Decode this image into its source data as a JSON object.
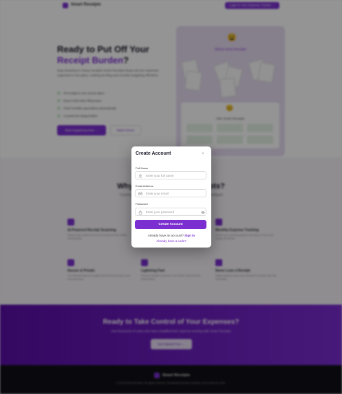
{
  "nav": {
    "brand": "Smart Receipts",
    "cta_label": "Login to Your Expense Tracker →"
  },
  "hero": {
    "title_line1": "Ready to Put Off Your",
    "title_accent": "Receipt Burden",
    "title_end": "?",
    "description": "Stop drowning in messy receipts! Smart Receipts keeps all your expenses organized in one place, making tax filing and monthly budgeting effortless.",
    "checklist": [
      "All receipts in one secure place",
      "Easy to find when filing taxes",
      "Track monthly expenditure automatically",
      "AI-powered categorization"
    ],
    "primary_button": "Start Organizing Now →",
    "secondary_button": "Watch Demo"
  },
  "illustration": {
    "before_title": "Before Smart Receipts",
    "after_title": "After Smart Receipts"
  },
  "features": {
    "title": "Why Choose Smart Receipts?",
    "subtitle": "Transform your receipt chaos into organized data with our intelligent",
    "items": [
      {
        "title": "AI-Powered Receipt Scanning",
        "desc": "Simply snap a photo and let our AI extract all the details automatically."
      },
      {
        "title": "Monthly Expense Tracking",
        "desc": "Monitor your spending patterns and stay on top of your budget effortlessly."
      },
      {
        "title": "Secure & Private",
        "desc": "Your financial data is encrypted and stored securely in your personal space."
      },
      {
        "title": "Lightning Fast",
        "desc": "Process receipts in seconds, not minutes. Save time for what matters."
      },
      {
        "title": "Never Lose a Receipt",
        "desc": "Digital backups ensure your receipts are always safe and accessible."
      }
    ]
  },
  "cta": {
    "title": "Ready to Take Control of Your Expenses?",
    "subtitle": "Join thousands of users who have simplified their expense tracking with Smart Receipts",
    "button": "Get Started Free →"
  },
  "footer": {
    "brand": "Smart Receipts",
    "copyright": "© 2025 Smart Receipts. All rights reserved. Simplifying expense tracking, one receipt at a time."
  },
  "modal": {
    "title": "Create Account",
    "close_glyph": "×",
    "full_name_label": "Full Name",
    "full_name_placeholder": "Enter your full name",
    "email_label": "Email Address",
    "email_placeholder": "Enter your email",
    "password_label": "Password",
    "password_placeholder": "Enter your password",
    "submit_label": "Create Account",
    "account_prompt": "Already have an account?",
    "sign_in_link": "Sign in",
    "code_link": "Already have a code?"
  },
  "icons": {
    "full_name": "user-icon",
    "email": "mail-icon",
    "password": "lock-icon",
    "toggle_password": "eye-icon",
    "close": "close-icon"
  },
  "colors": {
    "accent": "#7b2fd0",
    "accent_dark": "#5b0fa8",
    "footer_bg": "#111118"
  }
}
